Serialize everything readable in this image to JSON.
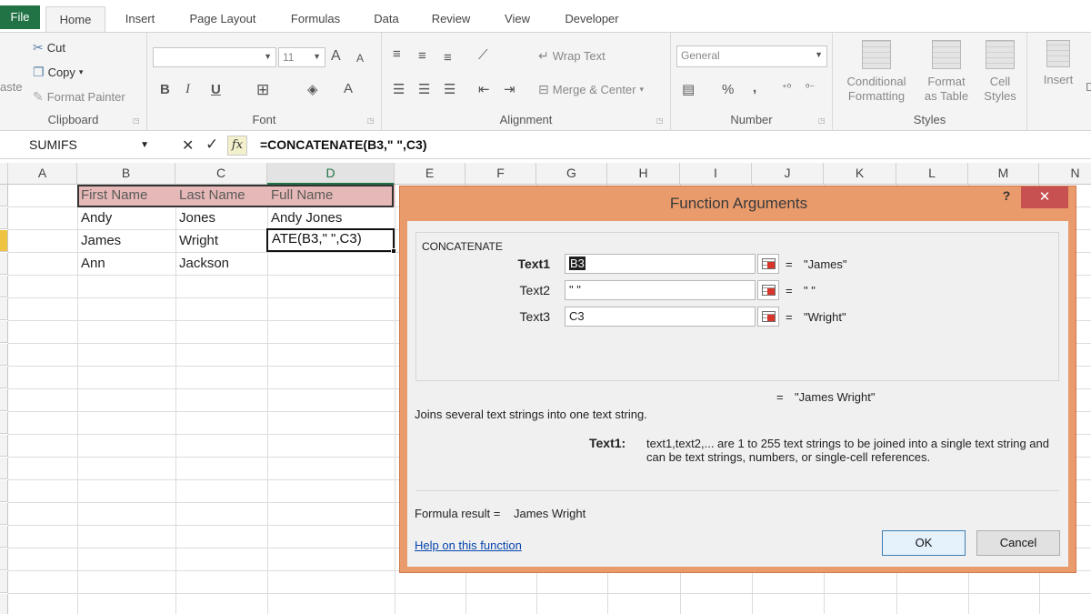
{
  "tabs": [
    "File",
    "Home",
    "Insert",
    "Page Layout",
    "Formulas",
    "Data",
    "Review",
    "View",
    "Developer"
  ],
  "ribbon": {
    "clipboard": {
      "paste": "aste",
      "cut": "Cut",
      "copy": "Copy",
      "format_painter": "Format Painter",
      "label": "Clipboard"
    },
    "font": {
      "font_size": "11",
      "bold": "B",
      "italic": "I",
      "underline": "U",
      "grow": "A",
      "shrink": "A",
      "color": "A",
      "label": "Font"
    },
    "alignment": {
      "wrap_text": "Wrap Text",
      "merge_center": "Merge & Center",
      "label": "Alignment"
    },
    "number": {
      "format": "General",
      "percent": "%",
      "comma": ",",
      "label": "Number"
    },
    "styles": {
      "conditional": "Conditional",
      "formatting": "Formatting",
      "format": "Format",
      "as_table": "as Table",
      "cell": "Cell",
      "styles_btn": "Styles",
      "label": "Styles"
    },
    "cells": {
      "insert": "Insert",
      "extra": "D"
    }
  },
  "formula_bar": {
    "name_box": "SUMIFS",
    "fx": "fx",
    "formula": "=CONCATENATE(B3,\" \",C3)"
  },
  "columns": [
    "A",
    "B",
    "C",
    "D",
    "E",
    "F",
    "G",
    "H",
    "I",
    "J",
    "K",
    "L",
    "M",
    "N"
  ],
  "cells": {
    "b1": "First Name",
    "c1": "Last Name",
    "d1": "Full Name",
    "b2": "Andy",
    "c2": "Jones",
    "d2": "Andy Jones",
    "b3": "James",
    "c3": "Wright",
    "d3": "ATE(B3,\" \",C3)",
    "b4": "Ann",
    "c4": "Jackson"
  },
  "dialog": {
    "title": "Function Arguments",
    "help": "?",
    "close": "✕",
    "function_name": "CONCATENATE",
    "args": [
      {
        "label": "Text1",
        "value": "B3",
        "result": "\"James\""
      },
      {
        "label": "Text2",
        "value": "\" \"",
        "result": "\" \""
      },
      {
        "label": "Text3",
        "value": "C3",
        "result": "\"Wright\""
      }
    ],
    "eq": "=",
    "result": "\"James Wright\"",
    "description": "Joins several text strings into one text string.",
    "arg_help_label": "Text1:",
    "arg_help_text": "text1,text2,... are 1 to 255 text strings to be joined into a single text string and can be text strings, numbers, or single-cell references.",
    "formula_result_label": "Formula result =",
    "formula_result_value": "James Wright",
    "help_link": "Help on this function",
    "ok": "OK",
    "cancel": "Cancel"
  },
  "colors": {
    "accent": "#217346",
    "header_fill": "#e6b8b7",
    "dialog_frame": "#ea9b6c",
    "close": "#c75050"
  }
}
